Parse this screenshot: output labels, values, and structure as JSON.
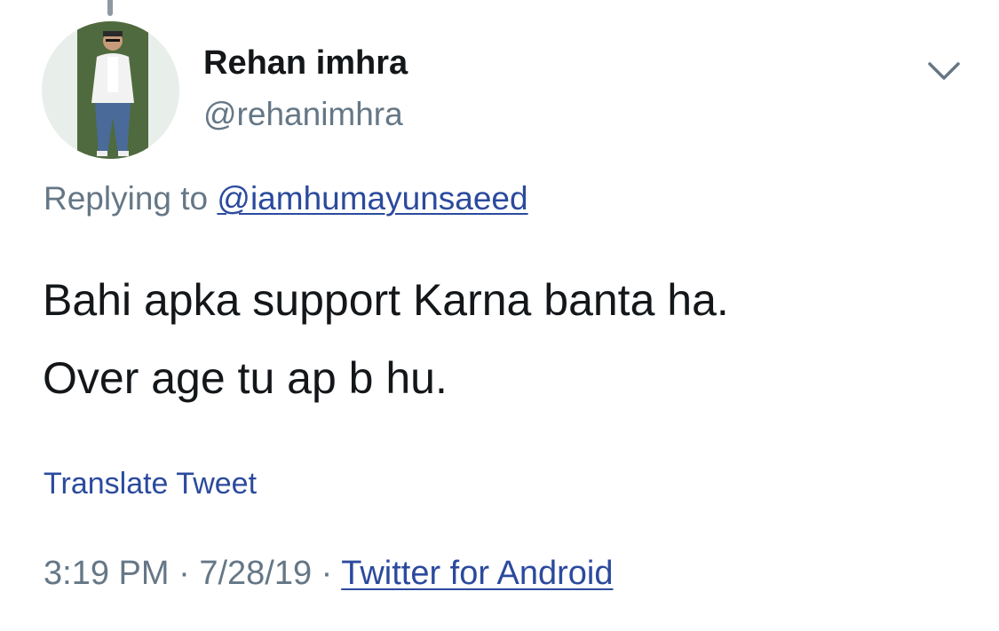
{
  "tweet": {
    "author": {
      "display_name": "Rehan imhra",
      "handle": "@rehanimhra",
      "avatar_icon": "person-photo-avatar"
    },
    "menu_icon": "chevron-down-icon",
    "reply": {
      "prefix": "Replying to ",
      "mention": "@iamhumayunsaeed"
    },
    "text_lines": [
      "Bahi apka support Karna banta ha.",
      "Over age tu ap b hu."
    ],
    "translate_label": "Translate Tweet",
    "time": "3:19 PM",
    "separator": " · ",
    "date": "7/28/19",
    "source": "Twitter for Android"
  },
  "colors": {
    "text_primary": "#14171a",
    "text_secondary": "#657786",
    "link": "#2b4a9e",
    "thread_line": "#8e99a3"
  }
}
